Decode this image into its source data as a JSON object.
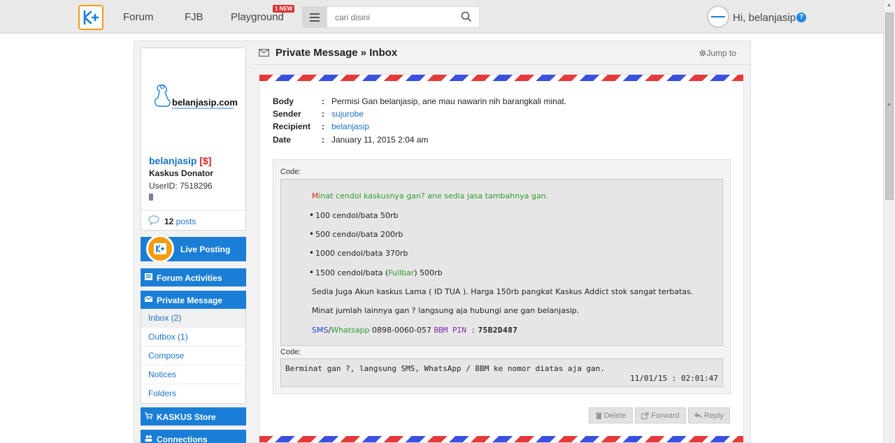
{
  "nav": {
    "forum": "Forum",
    "fjb": "FJB",
    "playground": "Playground",
    "new_badge": "1 NEW",
    "search_placeholder": "cari disini",
    "greeting": "Hi, belanjasip",
    "help": "?"
  },
  "profile": {
    "username": "belanjasip",
    "donor_tag": "[$]",
    "rank": "Kaskus Donator",
    "user_id": "UserID: 7518296",
    "post_count": "12",
    "posts_label": "posts",
    "logo_text": "belanjasip.com"
  },
  "sidebar": {
    "live_posting": "Live Posting",
    "forum_activities": "Forum Activities",
    "private_message": "Private Message",
    "pm_items": [
      "Inbox (2)",
      "Outbox (1)",
      "Compose",
      "Notices",
      "Folders"
    ],
    "kaskus_store": "KASKUS Store",
    "connections": "Connections"
  },
  "header": {
    "title": "Private Message » Inbox",
    "jump_to": "Jump to"
  },
  "message": {
    "body_label": "Body",
    "body": "Permisi Gan belanjasip, ane mau nawarin nih barangkali minat.",
    "sender_label": "Sender",
    "sender": "sujurobe",
    "recipient_label": "Recipient",
    "recipient": "belanjasip",
    "date_label": "Date",
    "date": "January 11, 2015 2:04 am",
    "colon": ":"
  },
  "code1": {
    "label": "Code:",
    "first_letter": "M",
    "intro": "inat cendol kaskusnya gan? ane sedia jasa tambahnya gan.",
    "items": [
      "100 cendol/bata 50rb",
      "500 cendol/bata 200rb",
      "1000 cendol/bata 370rb"
    ],
    "item4_pre": "1500 cendol/bata (",
    "item4_fullbar": "Fullbar",
    "item4_post": ") 500rb",
    "line_akun": "Sedia Juga Akun kaskus Lama ( ID TUA ). Harga 150rb pangkat Kaskus Addict stok sangat terbatas.",
    "line_minat": "Minat jumlah lainnya gan ? langsung aja hubungi ane gan belanjasip.",
    "sms": "SMS",
    "slash": "/",
    "whatsapp": "Whatsapp",
    "phone": " 0898-0060-057 ",
    "bbm_label": "BBM PIN :",
    "bbm_pin": "75B2D487"
  },
  "code2": {
    "label": "Code:",
    "text": "Berminat gan ?, langsung SMS, WhatsApp / BBM ke nomor diatas aja gan.",
    "time": "11/01/15 : 02:01:47"
  },
  "actions": {
    "delete": "Delete",
    "forward": "Forward",
    "reply": "Reply"
  },
  "colors": {
    "accent": "#1b7ed6",
    "link": "#1a73c7",
    "airmail_red": "#e5393b",
    "airmail_blue": "#3b4fe0",
    "logo_orange": "#f39c12"
  }
}
